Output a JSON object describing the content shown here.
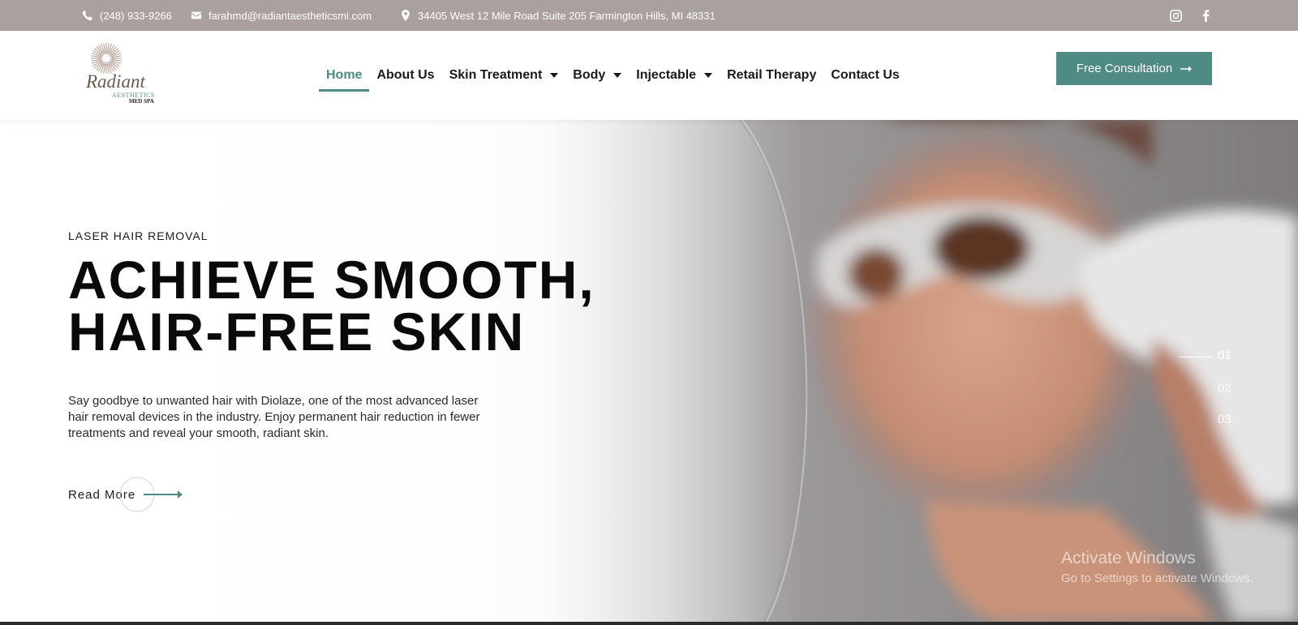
{
  "topbar": {
    "phone": "(248) 933-9266",
    "email": "farahmd@radiantaestheticsmi.com",
    "address": "34405 West 12 Mile Road Suite 205 Farmington Hills, MI 48331",
    "social": [
      "instagram-icon",
      "facebook-icon"
    ]
  },
  "logo": {
    "word": "Radiant",
    "sub1": "AESTHETICS",
    "sub2": "MED SPA"
  },
  "nav": {
    "items": [
      {
        "label": "Home",
        "active": true
      },
      {
        "label": "About Us"
      },
      {
        "label": "Skin Treatment",
        "dropdown": true
      },
      {
        "label": "Body",
        "dropdown": true
      },
      {
        "label": "Injectable",
        "dropdown": true
      },
      {
        "label": "Retail Therapy"
      },
      {
        "label": "Contact Us"
      }
    ]
  },
  "cta": {
    "label": "Free Consultation"
  },
  "hero": {
    "eyebrow": "LASER HAIR REMOVAL",
    "headline_1": "ACHIEVE SMOOTH,",
    "headline_2": "HAIR-FREE SKIN",
    "description": "Say goodbye to unwanted hair with Diolaze, one of the most advanced laser hair removal devices in the industry. Enjoy permanent hair reduction in fewer treatments and reveal your smooth, radiant skin.",
    "read_more": "Read More",
    "slides": [
      "01",
      "02",
      "03"
    ],
    "active_slide": "01"
  },
  "watermark": {
    "line1": "Activate Windows",
    "line2": "Go to Settings to activate Windows."
  },
  "colors": {
    "topbar": "#aaa19f",
    "accent": "#4f8b85",
    "text": "#0a0a0a"
  }
}
